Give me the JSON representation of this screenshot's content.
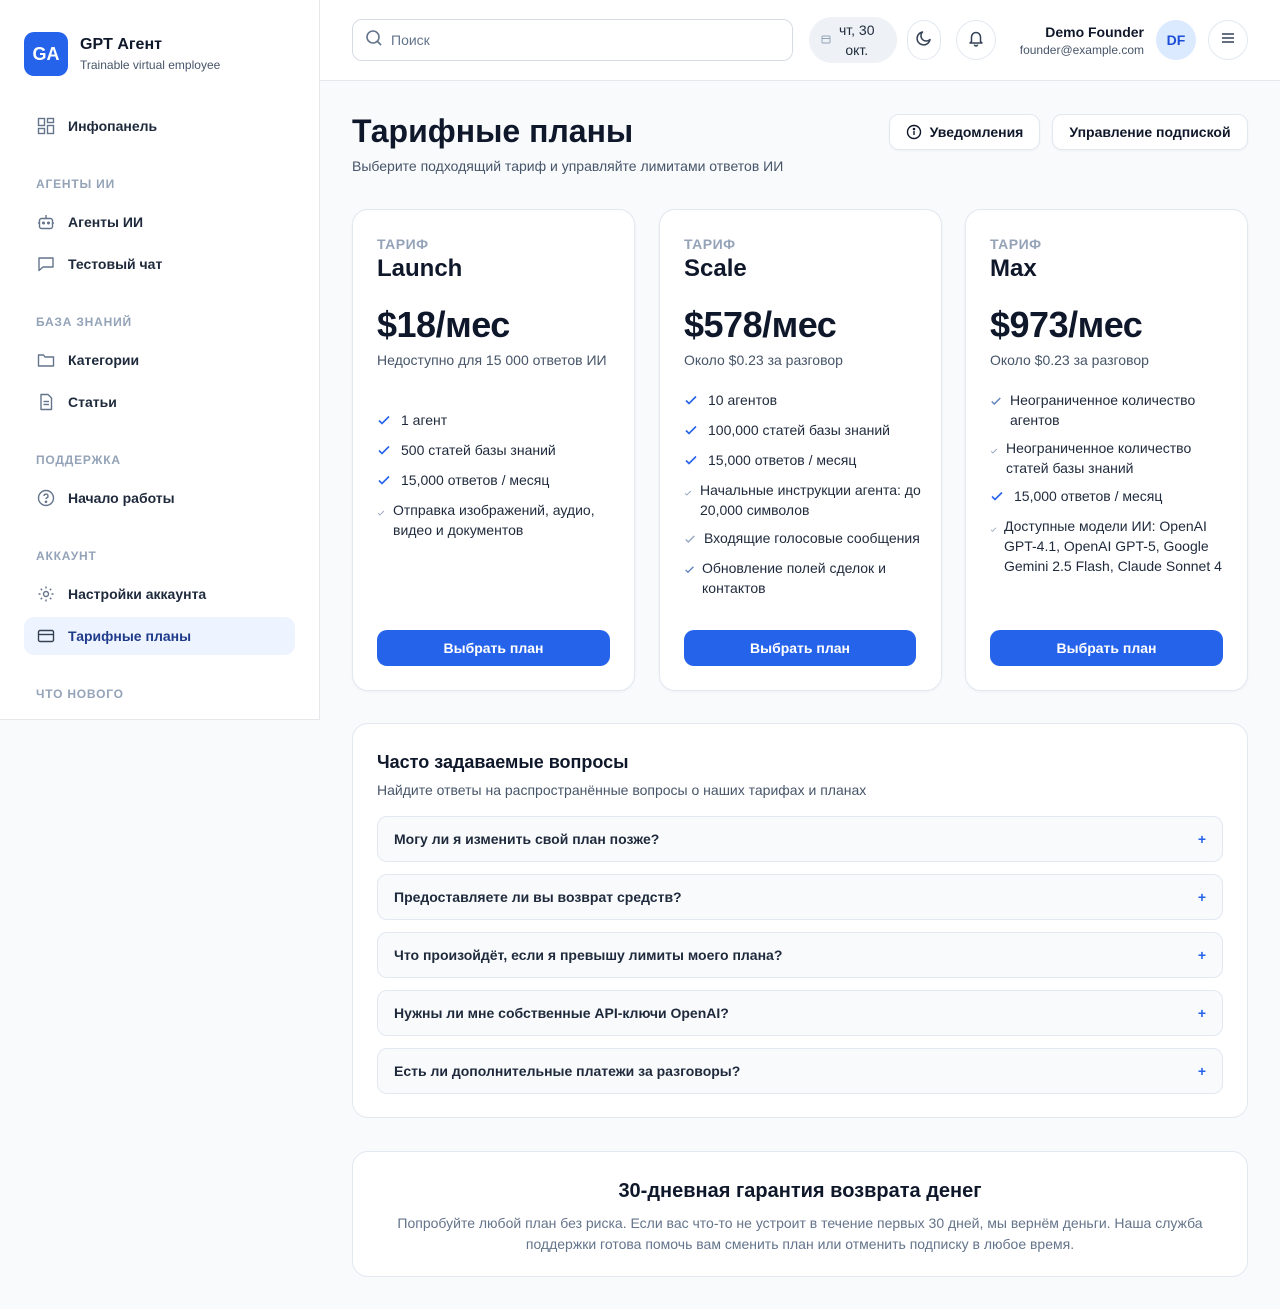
{
  "brand": {
    "logo": "GA",
    "title": "GPT Агент",
    "subtitle": "Trainable virtual employee"
  },
  "sidebar": {
    "dashboard": "Инфопанель",
    "sections": {
      "agents": "АГЕНТЫ ИИ",
      "kb": "БАЗА ЗНАНИЙ",
      "support": "ПОДДЕРЖКА",
      "account": "АККАУНТ",
      "news": "ЧТО НОВОГО"
    },
    "items": {
      "agents": "Агенты ИИ",
      "test_chat": "Тестовый чат",
      "categories": "Категории",
      "articles": "Статьи",
      "getting_started": "Начало работы",
      "account_settings": "Настройки аккаунта",
      "plans": "Тарифные планы"
    }
  },
  "header": {
    "search_placeholder": "Поиск",
    "date_line1": "чт, 30",
    "date_line2": "окт.",
    "user_name": "Demo Founder",
    "user_email": "founder@example.com",
    "avatar": "DF"
  },
  "page": {
    "title": "Тарифные планы",
    "subtitle": "Выберите подходящий тариф и управляйте лимитами ответов ИИ",
    "notifications_btn": "Уведомления",
    "manage_btn": "Управление подпиской"
  },
  "plans": [
    {
      "label": "ТАРИФ",
      "name": "Launch",
      "price": "$18/мес",
      "note": "Недоступно для 15 000 ответов ИИ",
      "features": [
        "1 агент",
        "500 статей базы знаний",
        "15,000 ответов / месяц",
        "Отправка изображений, аудио, видео и документов"
      ],
      "button": "Выбрать план"
    },
    {
      "label": "ТАРИФ",
      "name": "Scale",
      "price": "$578/мес",
      "note": "Около $0.23 за разговор",
      "features": [
        "10 агентов",
        "100,000 статей базы знаний",
        "15,000 ответов / месяц",
        "Начальные инструкции агента: до 20,000 символов",
        "Входящие голосовые сообщения",
        "Обновление полей сделок и контактов"
      ],
      "button": "Выбрать план"
    },
    {
      "label": "ТАРИФ",
      "name": "Max",
      "price": "$973/мес",
      "note": "Около $0.23 за разговор",
      "features": [
        "Неограниченное количество агентов",
        "Неограниченное количество статей базы знаний",
        "15,000 ответов / месяц",
        "Доступные модели ИИ: OpenAI GPT-4.1, OpenAI GPT-5, Google Gemini 2.5 Flash, Claude Sonnet 4"
      ],
      "button": "Выбрать план"
    }
  ],
  "faq": {
    "title": "Часто задаваемые вопросы",
    "subtitle": "Найдите ответы на распространённые вопросы о наших тарифах и планах",
    "items": [
      "Могу ли я изменить свой план позже?",
      "Предоставляете ли вы возврат средств?",
      "Что произойдёт, если я превышу лимиты моего плана?",
      "Нужны ли мне собственные API-ключи OpenAI?",
      "Есть ли дополнительные платежи за разговоры?"
    ],
    "toggle": "+"
  },
  "guarantee": {
    "title": "30-дневная гарантия возврата денег",
    "text": "Попробуйте любой план без риска. Если вас что-то не устроит в течение первых 30 дней, мы вернём деньги. Наша служба поддержки готова помочь вам сменить план или отменить подписку в любое время."
  },
  "colors": {
    "accent": "#2563eb",
    "active_bg": "#eef4ff",
    "muted": "#94a3b8"
  }
}
